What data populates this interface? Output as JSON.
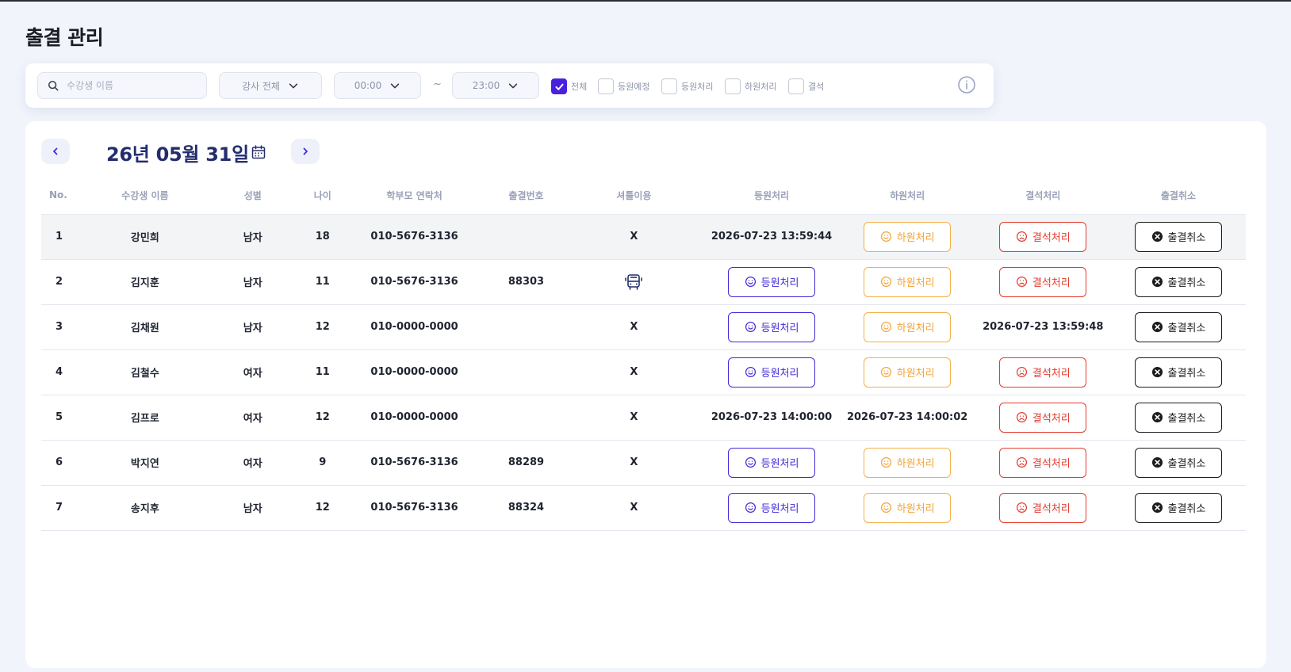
{
  "page": {
    "title": "출결 관리"
  },
  "filters": {
    "search_placeholder": "수강생 이름",
    "teacher_select": "강사 전체",
    "time_start": "00:00",
    "time_separator": "~",
    "time_end": "23:00",
    "checkboxes": [
      {
        "label": "전체",
        "checked": true
      },
      {
        "label": "등원예정",
        "checked": false
      },
      {
        "label": "등원처리",
        "checked": false
      },
      {
        "label": "하원처리",
        "checked": false
      },
      {
        "label": "결석",
        "checked": false
      }
    ]
  },
  "date_nav": {
    "date": "26년 05월 31일"
  },
  "table": {
    "headers": [
      "No.",
      "수강생 이름",
      "성별",
      "나이",
      "학부모 연락처",
      "출결번호",
      "셔틀이용",
      "등원처리",
      "하원처리",
      "결석처리",
      "출결취소"
    ],
    "action_labels": {
      "enter": "등원처리",
      "exit": "하원처리",
      "absent": "결석처리",
      "cancel": "출결취소"
    },
    "rows": [
      {
        "no": "1",
        "name": "강민희",
        "gender": "남자",
        "age": "18",
        "phone": "010-5676-3136",
        "code": "",
        "shuttle": "X",
        "enter": "2026-07-23 13:59:44",
        "exit": null,
        "absent": null,
        "highlight": true
      },
      {
        "no": "2",
        "name": "김지훈",
        "gender": "남자",
        "age": "11",
        "phone": "010-5676-3136",
        "code": "88303",
        "shuttle": "bus-icon",
        "enter": null,
        "exit": null,
        "absent": null
      },
      {
        "no": "3",
        "name": "김채원",
        "gender": "남자",
        "age": "12",
        "phone": "010-0000-0000",
        "code": "",
        "shuttle": "X",
        "enter": null,
        "exit": null,
        "absent": "2026-07-23 13:59:48"
      },
      {
        "no": "4",
        "name": "김철수",
        "gender": "여자",
        "age": "11",
        "phone": "010-0000-0000",
        "code": "",
        "shuttle": "X",
        "enter": null,
        "exit": null,
        "absent": null
      },
      {
        "no": "5",
        "name": "김프로",
        "gender": "여자",
        "age": "12",
        "phone": "010-0000-0000",
        "code": "",
        "shuttle": "X",
        "enter": "2026-07-23 14:00:00",
        "exit": "2026-07-23 14:00:02",
        "absent": null
      },
      {
        "no": "6",
        "name": "박지연",
        "gender": "여자",
        "age": "9",
        "phone": "010-5676-3136",
        "code": "88289",
        "shuttle": "X",
        "enter": null,
        "exit": null,
        "absent": null
      },
      {
        "no": "7",
        "name": "송지후",
        "gender": "남자",
        "age": "12",
        "phone": "010-5676-3136",
        "code": "88324",
        "shuttle": "X",
        "enter": null,
        "exit": null,
        "absent": null
      }
    ]
  },
  "colors": {
    "accent": "#4a20e0",
    "enter": "#3f2ad8",
    "exit": "#f3a43a",
    "absent": "#e23b2e",
    "date": "#232d6e"
  }
}
